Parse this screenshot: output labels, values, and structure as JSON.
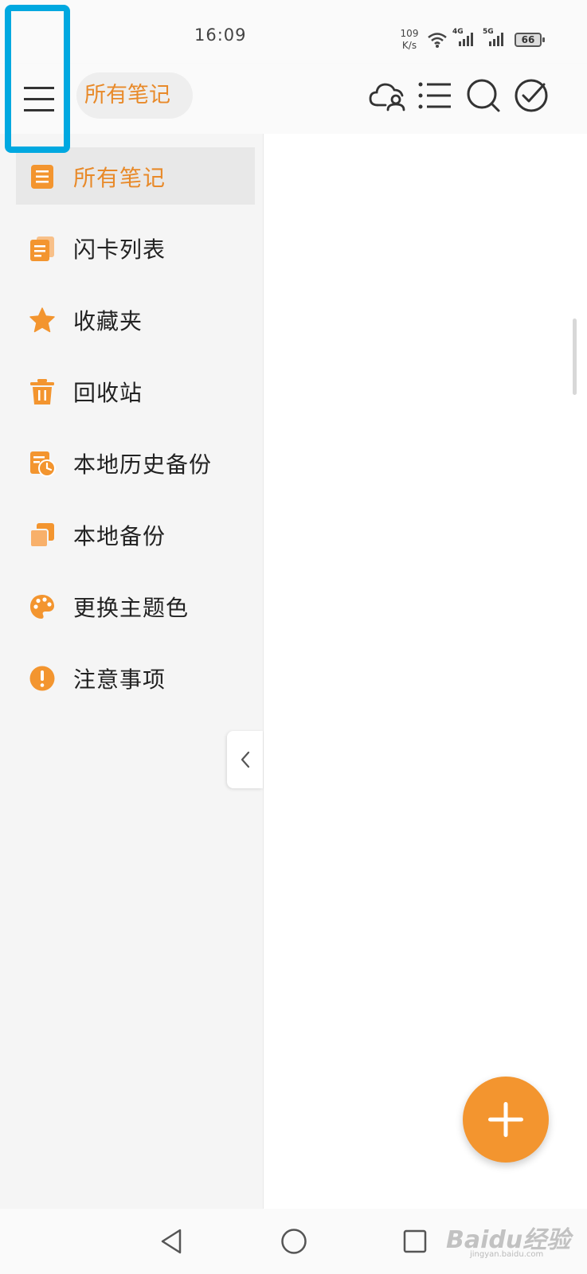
{
  "status_bar": {
    "time": "16:09",
    "net_speed_value": "109",
    "net_speed_unit": "K/s",
    "signal1_gen": "4G",
    "signal2_gen": "5G",
    "battery": "66"
  },
  "app_bar": {
    "title": "所有笔记"
  },
  "sidebar": {
    "items": [
      {
        "label": "所有笔记",
        "icon": "notes-list-icon"
      },
      {
        "label": "闪卡列表",
        "icon": "flashcards-icon"
      },
      {
        "label": "收藏夹",
        "icon": "star-icon"
      },
      {
        "label": "回收站",
        "icon": "trash-icon"
      },
      {
        "label": "本地历史备份",
        "icon": "history-backup-icon"
      },
      {
        "label": "本地备份",
        "icon": "copy-backup-icon"
      },
      {
        "label": "更换主题色",
        "icon": "palette-icon"
      },
      {
        "label": "注意事项",
        "icon": "warning-icon"
      }
    ]
  },
  "watermark": {
    "brand": "Baidu经验",
    "url": "jingyan.baidu.com"
  },
  "colors": {
    "accent": "#f3952f",
    "highlight": "#00a8e0"
  }
}
